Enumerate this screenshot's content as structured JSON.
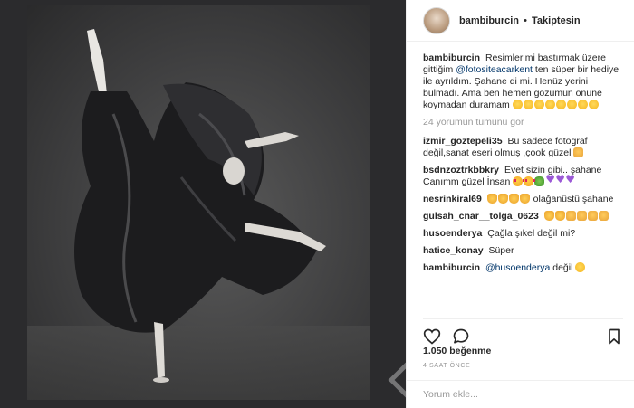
{
  "post": {
    "username": "bambiburcin",
    "follow_dot": "•",
    "follow_status": "Takiptesin",
    "caption": {
      "user": "bambiburcin",
      "text_before": "Resimlerimi bastırmak üzere gittiğim",
      "mention": "@fotositeacarkent",
      "text_after": "ten süper bir hediye ile ayrıldım. Şahane di mi. Henüz yerini bulmadı. Ama ben hemen gözümün önüne koymadan duramam"
    },
    "view_all": "24 yorumun tümünü gör",
    "comments": [
      {
        "user": "izmir_goztepeli35",
        "text": "Bu sadece fotograf değil,sanat eseri olmuş ,çook güzel"
      },
      {
        "user": "bsdnzoztrkbbkry",
        "text": "Evet sizin gibi.. şahane Canımm güzel İnsan"
      },
      {
        "user": "nesrinkiral69",
        "text": "olağanüstü şahane"
      },
      {
        "user": "gulsah_cnar__tolga_0623",
        "text": ""
      },
      {
        "user": "husoenderya",
        "text": "Çağla şıkel değil mi?"
      },
      {
        "user": "hatice_konay",
        "text": "Süper"
      },
      {
        "user": "bambiburcin",
        "mention": "@husoenderya",
        "text": "değil"
      }
    ],
    "likes": "1.050 beğenme",
    "time": "4 SAAT ÖNCE",
    "add_comment_placeholder": "Yorum ekle..."
  },
  "icons": {
    "like": "heart-icon",
    "comment": "comment-icon",
    "save": "bookmark-icon"
  },
  "colors": {
    "mention": "#003569",
    "muted": "#999999",
    "text": "#262626"
  }
}
